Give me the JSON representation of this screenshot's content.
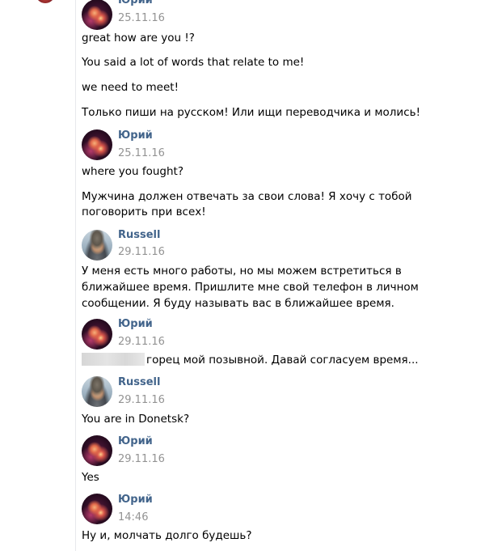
{
  "messages": [
    {
      "author": "Юрий",
      "avatar_icon": "yuri-avatar",
      "date": "25.11.16",
      "lines": [
        "great how are you !?",
        "You said a lot of words that relate to me!",
        "we need to meet!",
        "Только пиши на русском! Или ищи переводчика и молись!"
      ]
    },
    {
      "author": "Юрий",
      "avatar_icon": "yuri-avatar",
      "date": "25.11.16",
      "lines": [
        "where you fought?",
        "Мужчина должен отвечать за свои слова! Я хочу с тобой",
        "поговорить при всех!"
      ]
    },
    {
      "author": "Russell",
      "avatar_icon": "russell-avatar",
      "date": "29.11.16",
      "lines": [
        "У меня есть много работы, но мы можем встретиться в",
        "ближайшее время. Пришлите мне свой телефон в личном",
        "сообщении. Я буду называть вас в ближайшее время."
      ]
    },
    {
      "author": "Юрий",
      "avatar_icon": "yuri-avatar",
      "date": "29.11.16",
      "lines": [
        "горец мой позывной. Давай согласуем время..."
      ]
    },
    {
      "author": "Russell",
      "avatar_icon": "russell-avatar",
      "date": "29.11.16",
      "lines": [
        "You are in Donetsk?"
      ]
    },
    {
      "author": "Юрий",
      "avatar_icon": "yuri-avatar",
      "date": "29.11.16",
      "lines": [
        "Yes"
      ]
    },
    {
      "author": "Юрий",
      "avatar_icon": "yuri-avatar",
      "date": "14:46",
      "lines": [
        "Ну и, молчать долго будешь?"
      ]
    }
  ],
  "colors": {
    "author": "#42648b",
    "date": "#939393",
    "text": "#000000",
    "redaction": "#d8d8d8"
  }
}
